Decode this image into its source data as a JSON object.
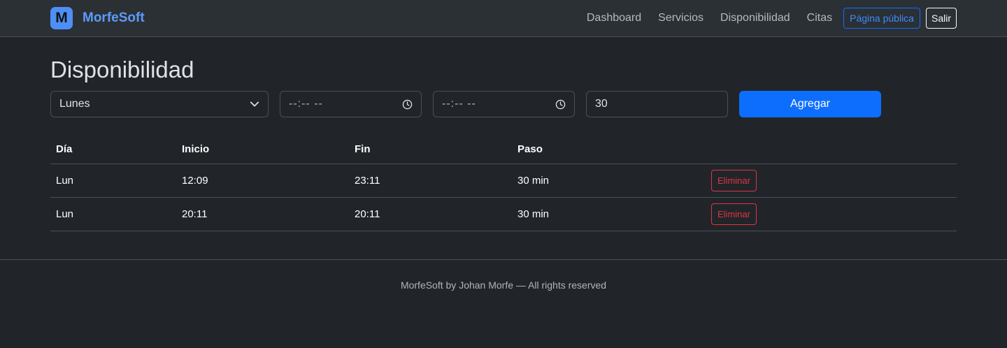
{
  "navbar": {
    "logo_letter": "M",
    "brand": "MorfeSoft",
    "links": [
      "Dashboard",
      "Servicios",
      "Disponibilidad",
      "Citas"
    ],
    "public_page_label": "Página pública",
    "logout_label": "Salir"
  },
  "page": {
    "title": "Disponibilidad"
  },
  "form": {
    "day_selected": "Lunes",
    "start_time_placeholder": "--:-- --",
    "end_time_placeholder": "--:-- --",
    "step_value": "30",
    "add_label": "Agregar"
  },
  "table": {
    "headers": [
      "Día",
      "Inicio",
      "Fin",
      "Paso",
      ""
    ],
    "rows": [
      {
        "day": "Lun",
        "start": "12:09",
        "end": "23:11",
        "step": "30 min",
        "action": "Eliminar"
      },
      {
        "day": "Lun",
        "start": "20:11",
        "end": "20:11",
        "step": "30 min",
        "action": "Eliminar"
      }
    ]
  },
  "footer": {
    "text": "MorfeSoft by Johan Morfe — All rights reserved"
  },
  "colors": {
    "background": "#212529",
    "navbar": "#2b3035",
    "primary": "#0d6efd",
    "brand": "#5c9cf8",
    "danger": "#dc3545"
  },
  "icons": {
    "select": "chevron-down-icon",
    "time": "clock-icon"
  }
}
